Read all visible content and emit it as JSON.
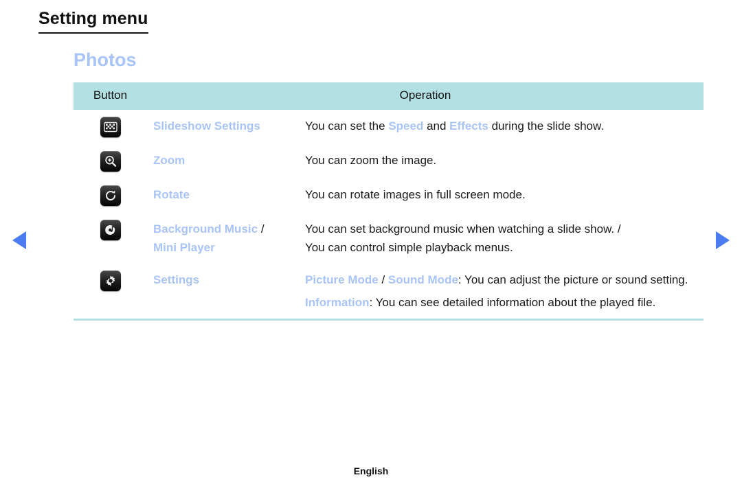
{
  "page": {
    "heading": "Setting menu",
    "section_title": "Photos",
    "footer_language": "English"
  },
  "colors": {
    "accent_blue": "#a9c4f7",
    "table_header_bg": "#b2e0e3",
    "table_border": "#b2e0e3",
    "arrow_blue": "#4b7bf0",
    "text": "#1a1a1a"
  },
  "nav": {
    "prev_label": "Previous page",
    "next_label": "Next page"
  },
  "table": {
    "headers": {
      "button": "Button",
      "operation": "Operation"
    },
    "rows": [
      {
        "icon": "slideshow-settings-icon",
        "name": "Slideshow Settings",
        "operation_parts": [
          {
            "text": "You can set the ",
            "style": "plain"
          },
          {
            "text": "Speed",
            "style": "highlight"
          },
          {
            "text": " and ",
            "style": "plain"
          },
          {
            "text": "Effects",
            "style": "highlight"
          },
          {
            "text": " during the slide show.",
            "style": "plain"
          }
        ]
      },
      {
        "icon": "zoom-in-icon",
        "name": "Zoom",
        "operation_parts": [
          {
            "text": "You can zoom the image.",
            "style": "plain"
          }
        ]
      },
      {
        "icon": "rotate-icon",
        "name": "Rotate",
        "operation_parts": [
          {
            "text": "You can rotate images in full screen mode.",
            "style": "plain"
          }
        ]
      },
      {
        "icon": "background-music-icon",
        "name_parts": [
          {
            "text": "Background Music",
            "style": "highlight"
          },
          {
            "text": " /",
            "style": "plain"
          },
          {
            "text": "Mini Player",
            "style": "highlight",
            "newline": true
          }
        ],
        "name": "Background Music / Mini Player",
        "operation_parts": [
          {
            "text": "You can set background music when watching a slide show. /",
            "style": "plain"
          },
          {
            "text": "You can control simple playback menus.",
            "style": "plain",
            "newline": true
          }
        ]
      },
      {
        "icon": "settings-gear-icon",
        "name": "Settings",
        "operation_paragraphs": [
          [
            {
              "text": "Picture Mode",
              "style": "highlight"
            },
            {
              "text": " / ",
              "style": "plain"
            },
            {
              "text": "Sound Mode",
              "style": "highlight"
            },
            {
              "text": ": You can adjust the picture or sound setting.",
              "style": "plain"
            }
          ],
          [
            {
              "text": "Information",
              "style": "highlight"
            },
            {
              "text": ": You can see detailed information about the played file.",
              "style": "plain"
            }
          ]
        ]
      }
    ]
  }
}
